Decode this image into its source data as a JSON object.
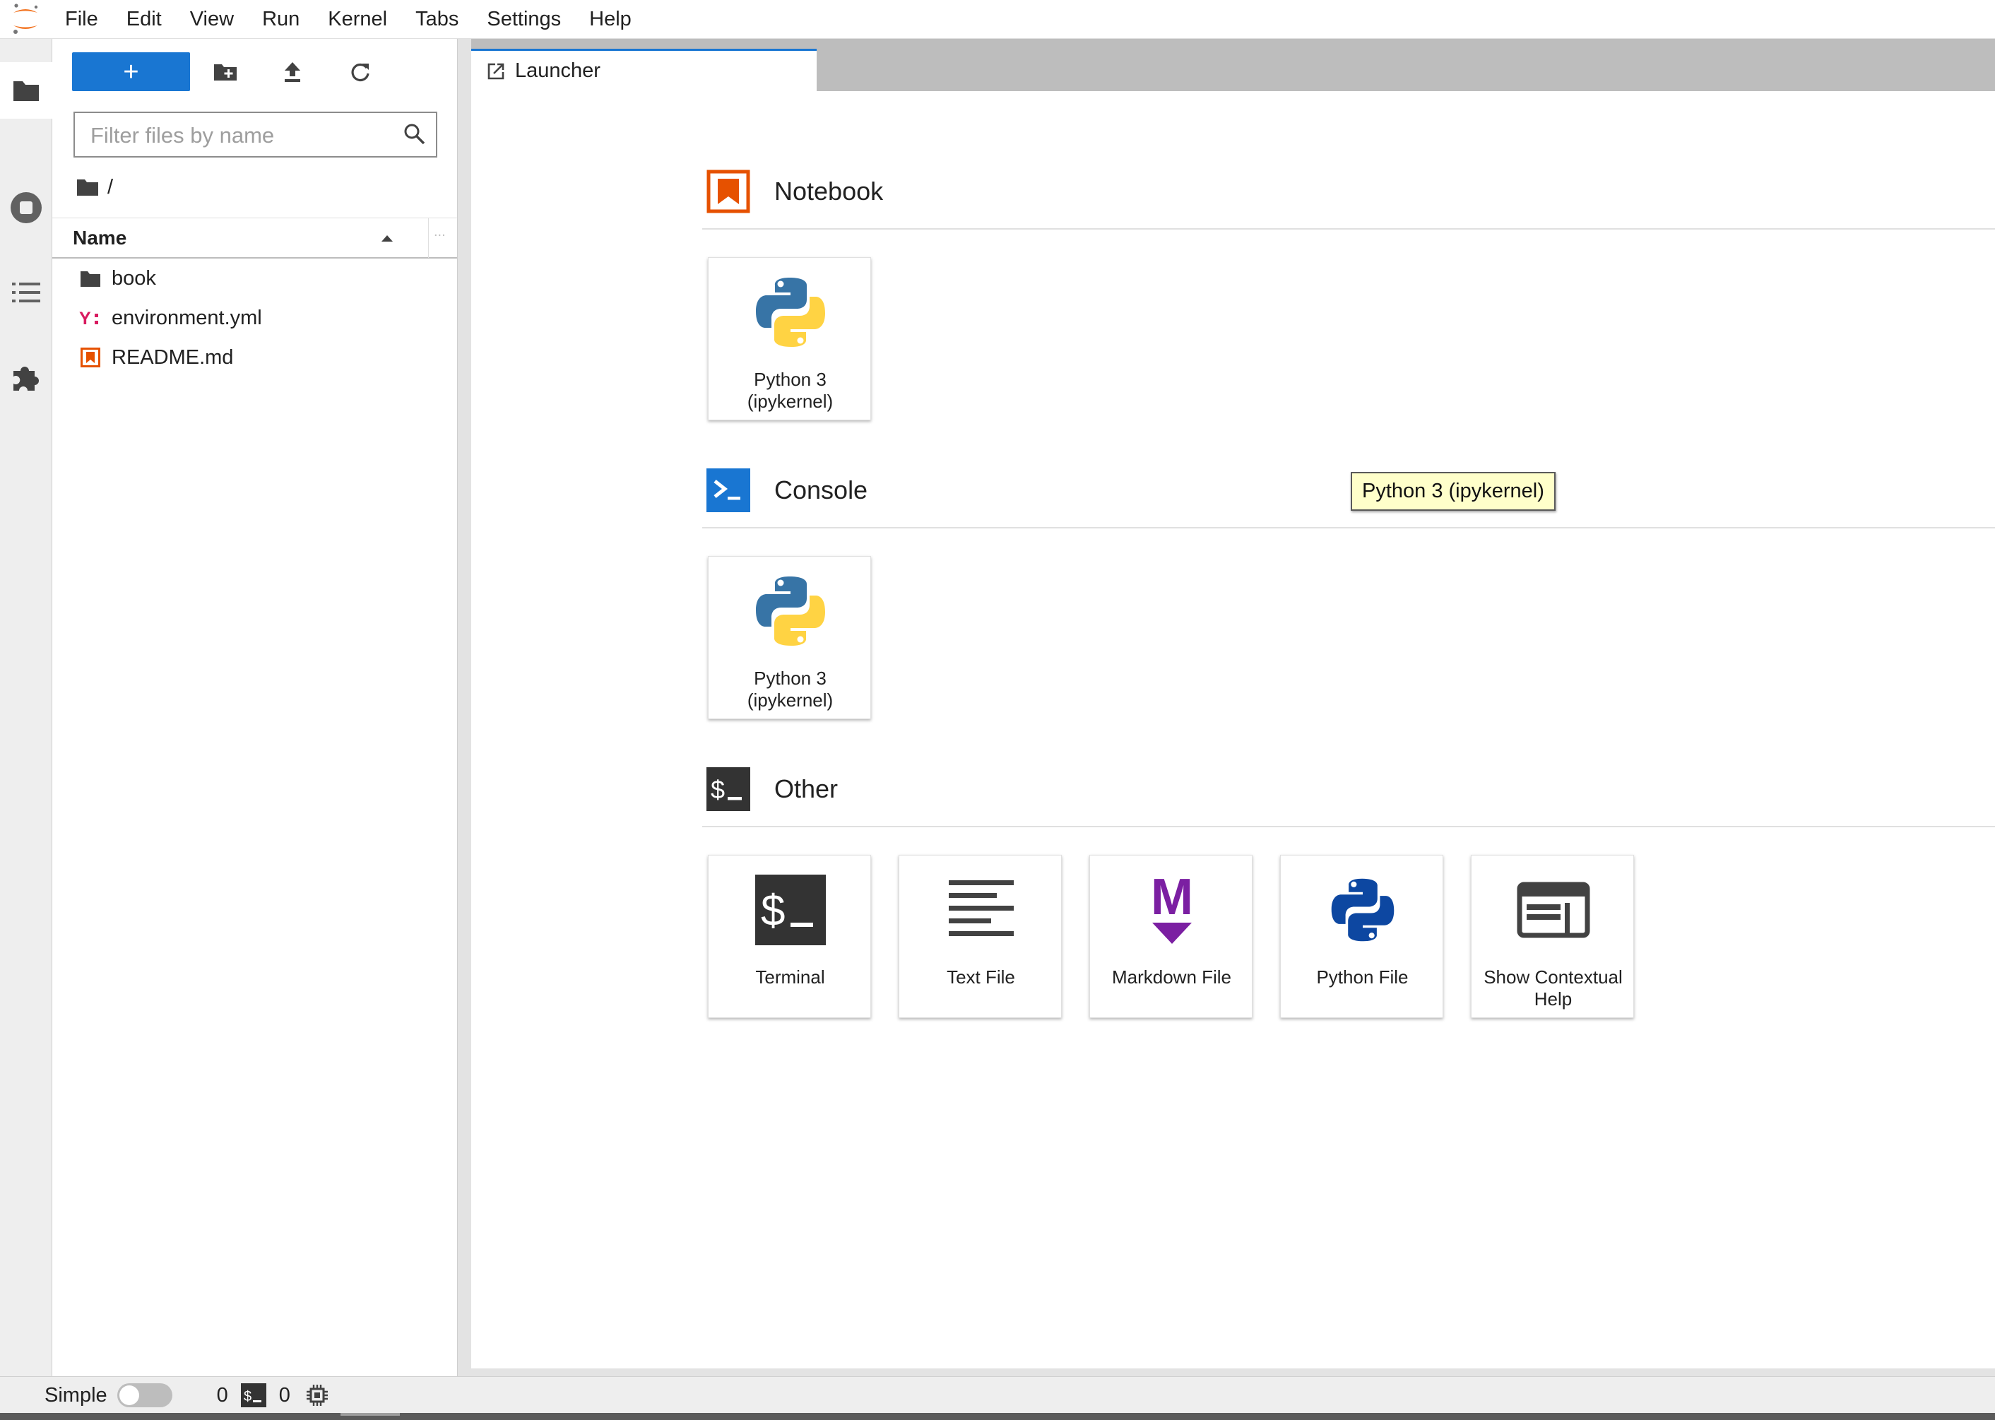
{
  "menubar": {
    "logo_icon": "jupyter-logo-icon",
    "items": [
      "File",
      "Edit",
      "View",
      "Run",
      "Kernel",
      "Tabs",
      "Settings",
      "Help"
    ]
  },
  "activity_bar": {
    "items": [
      {
        "name": "file-browser",
        "icon": "folder-icon",
        "active": true
      },
      {
        "name": "running-kernels",
        "icon": "stop-circle-icon"
      },
      {
        "name": "table-of-contents",
        "icon": "list-icon"
      },
      {
        "name": "extension-manager",
        "icon": "puzzle-icon"
      }
    ]
  },
  "file_browser": {
    "new_launcher_symbol": "+",
    "toolbar_icons": [
      "new-folder-icon",
      "upload-icon",
      "refresh-icon"
    ],
    "filter": {
      "placeholder": "Filter files by name",
      "value": ""
    },
    "breadcrumb": "/",
    "column_name": "Name",
    "sort": "ascending",
    "column_more": "...",
    "files": [
      {
        "name": "book",
        "icon": "folder-icon",
        "type": "directory"
      },
      {
        "name": "environment.yml",
        "icon": "yaml-icon",
        "type": "file"
      },
      {
        "name": "README.md",
        "icon": "markdown-file-icon",
        "type": "file"
      }
    ]
  },
  "tabs": [
    {
      "label": "Launcher",
      "icon": "launcher-tab-icon",
      "active": true
    }
  ],
  "launcher": {
    "sections": [
      {
        "title": "Notebook",
        "icon": "notebook-icon",
        "color": "#e65100",
        "cards": [
          {
            "label": "Python 3 (ipykernel)",
            "icon": "python-logo-icon"
          }
        ]
      },
      {
        "title": "Console",
        "icon": "console-icon",
        "color": "#1976d2",
        "cards": [
          {
            "label": "Python 3 (ipykernel)",
            "icon": "python-logo-icon"
          }
        ]
      },
      {
        "title": "Other",
        "icon": "terminal-icon",
        "color": "#333333",
        "cards": [
          {
            "label": "Terminal",
            "icon": "terminal-icon"
          },
          {
            "label": "Text File",
            "icon": "text-file-icon"
          },
          {
            "label": "Markdown File",
            "icon": "markdown-icon"
          },
          {
            "label": "Python File",
            "icon": "python-file-icon"
          },
          {
            "label": "Show Contextual Help",
            "icon": "contextual-help-icon"
          }
        ]
      }
    ],
    "tooltip": "Python 3 (ipykernel)"
  },
  "statusbar": {
    "simple_label": "Simple",
    "simple_mode_on": false,
    "kernels_count": "0",
    "terminals_count": "0",
    "terminal_icon": "terminal-icon",
    "kernel_status_icon": "cpu-icon"
  },
  "colors": {
    "accent_blue": "#1976d2",
    "notebook_orange": "#e65100",
    "markdown_purple": "#7b1fa2",
    "yaml_pink": "#d81b60",
    "tooltip_bg": "#ffffca"
  }
}
